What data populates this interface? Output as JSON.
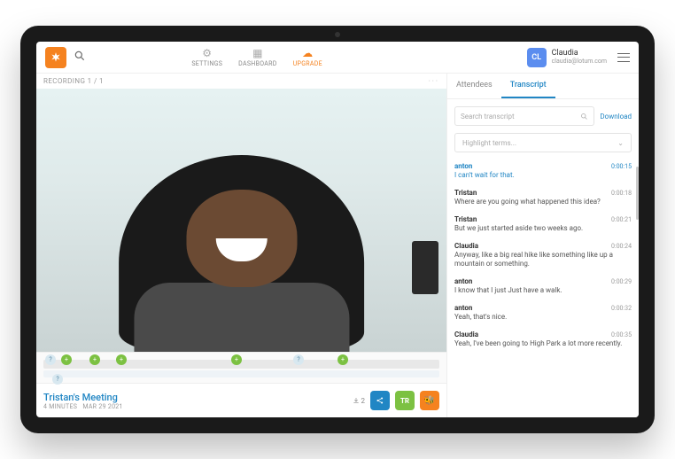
{
  "header": {
    "nav": {
      "settings": "SETTINGS",
      "dashboard": "DASHBOARD",
      "upgrade": "UPGRADE"
    },
    "user": {
      "initials": "CL",
      "name": "Claudia",
      "email": "claudia@lotum.com"
    }
  },
  "recording": {
    "label": "RECORDING 1 / 1"
  },
  "meta": {
    "title": "Tristan's Meeting",
    "duration": "4 MINUTES",
    "date": "MAR 29 2021",
    "attendee_count": "2",
    "tr_badge": "TR"
  },
  "sidebar": {
    "tabs": {
      "attendees": "Attendees",
      "transcript": "Transcript"
    },
    "search_placeholder": "Search transcript",
    "download": "Download",
    "highlight_placeholder": "Highlight terms..."
  },
  "transcript": [
    {
      "speaker": "anton",
      "ts": "0:00:15",
      "text": "I can't wait for that.",
      "hl": true
    },
    {
      "speaker": "Tristan",
      "ts": "0:00:18",
      "text": "Where are you going what happened this idea?"
    },
    {
      "speaker": "Tristan",
      "ts": "0:00:21",
      "text": "But we just started aside two weeks ago."
    },
    {
      "speaker": "Claudia",
      "ts": "0:00:24",
      "text": "Anyway, like a big real hike like something like up a mountain or something."
    },
    {
      "speaker": "anton",
      "ts": "0:00:29",
      "text": "I know that I just Just have a walk."
    },
    {
      "speaker": "anton",
      "ts": "0:00:32",
      "text": "Yeah, that's nice."
    },
    {
      "speaker": "Claudia",
      "ts": "0:00:35",
      "text": "Yeah, I've been going to High Park a lot more recently."
    }
  ]
}
